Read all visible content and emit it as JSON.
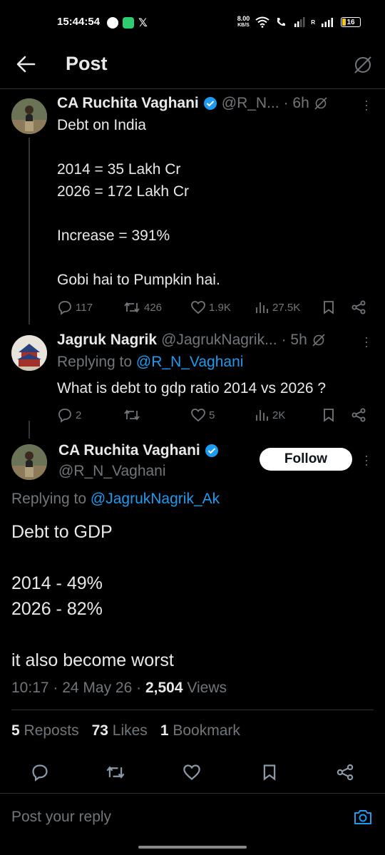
{
  "status_bar": {
    "time": "15:44:54",
    "net_speed_top": "8.00",
    "net_speed_bottom": "KB/S",
    "roaming_label": "R",
    "battery": "16"
  },
  "header": {
    "title": "Post"
  },
  "tweet1": {
    "author_name": "CA Ruchita Vaghani",
    "author_handle": "@R_N...",
    "time": "· 6h",
    "text": "Debt on India\n\n2014 = 35 Lakh Cr\n2026 = 172 Lakh Cr\n\nIncrease = 391%\n\nGobi hai to Pumpkin hai.",
    "replies": "117",
    "reposts": "426",
    "likes": "1.9K",
    "views": "27.5K"
  },
  "tweet2": {
    "author_name": "Jagruk Nagrik",
    "author_handle": "@JagrukNagrik...",
    "time": "· 5h",
    "replying_prefix": "Replying to",
    "replying_to": "@R_N_Vaghani",
    "text": "What is debt to gdp ratio 2014 vs 2026 ?",
    "replies": "2",
    "likes": "5",
    "views": "2K"
  },
  "main_tweet": {
    "author_name": "CA Ruchita Vaghani",
    "author_handle": "@R_N_Vaghani",
    "follow_label": "Follow",
    "replying_prefix": "Replying to",
    "replying_to": "@JagrukNagrik_Ak",
    "text": "Debt to GDP\n\n2014 - 49%\n2026 - 82%\n\nit also become worst",
    "timestamp": "10:17 · 24 May 26 ·",
    "views_count": "2,504",
    "views_label": "Views",
    "reposts_count": "5",
    "reposts_label": "Reposts",
    "likes_count": "73",
    "likes_label": "Likes",
    "bookmarks_count": "1",
    "bookmarks_label": "Bookmark"
  },
  "reply_box": {
    "placeholder": "Post your reply"
  },
  "colors": {
    "accent": "#1d9bf0",
    "background": "#000000",
    "muted": "#71767b"
  }
}
